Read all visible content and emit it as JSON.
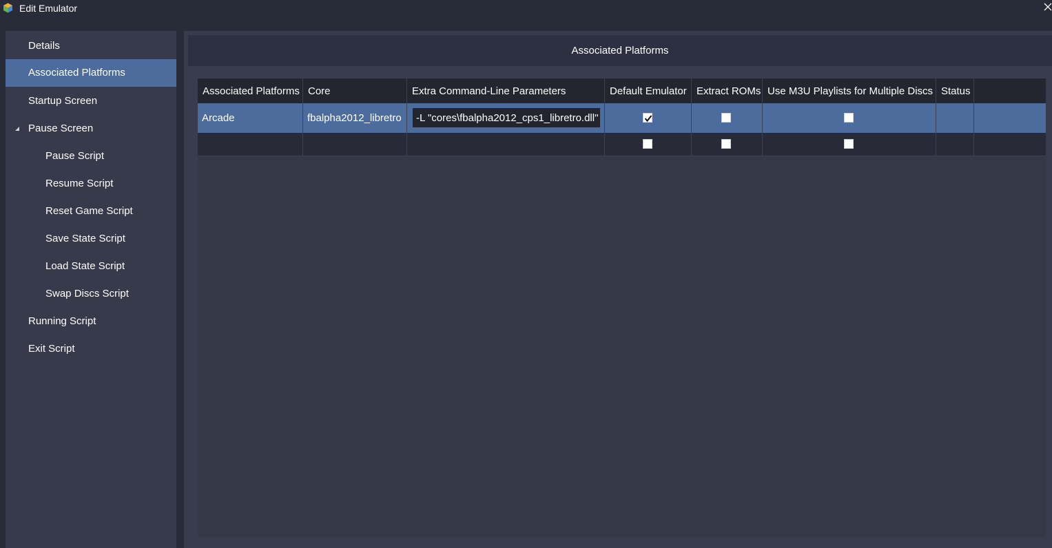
{
  "window": {
    "title": "Edit Emulator",
    "app_icon": "launchbox-icon",
    "close_icon": "close-icon"
  },
  "sidebar": {
    "selected": "Associated Platforms",
    "items": [
      {
        "label": "Details",
        "level": 0
      },
      {
        "label": "Associated Platforms",
        "level": 0,
        "selected": true
      },
      {
        "label": "Startup Screen",
        "level": 0
      },
      {
        "label": "Pause Screen",
        "level": 0,
        "expanded": true
      },
      {
        "label": "Pause Script",
        "level": 1
      },
      {
        "label": "Resume Script",
        "level": 1
      },
      {
        "label": "Reset Game Script",
        "level": 1
      },
      {
        "label": "Save State Script",
        "level": 1
      },
      {
        "label": "Load State Script",
        "level": 1
      },
      {
        "label": "Swap Discs Script",
        "level": 1
      },
      {
        "label": "Running Script",
        "level": 0
      },
      {
        "label": "Exit Script",
        "level": 0
      }
    ]
  },
  "panel": {
    "title": "Associated Platforms",
    "columns": [
      "Associated Platforms",
      "Core",
      "Extra Command-Line Parameters",
      "Default Emulator",
      "Extract ROMs",
      "Use M3U Playlists for Multiple Discs",
      "Status"
    ],
    "rows": [
      {
        "platform": "Arcade",
        "core": "fbalpha2012_libretro",
        "params": "-L \"cores\\fbalpha2012_cps1_libretro.dll\"",
        "default_emulator": true,
        "extract_roms": false,
        "use_m3u": false,
        "status": "",
        "selected": true
      },
      {
        "platform": "",
        "core": "",
        "params": "",
        "default_emulator": false,
        "extract_roms": false,
        "use_m3u": false,
        "status": ""
      }
    ]
  },
  "colors": {
    "background": "#282b38",
    "sidebar": "#363a4a",
    "selection": "#4b6c9d",
    "header": "#23262f"
  }
}
